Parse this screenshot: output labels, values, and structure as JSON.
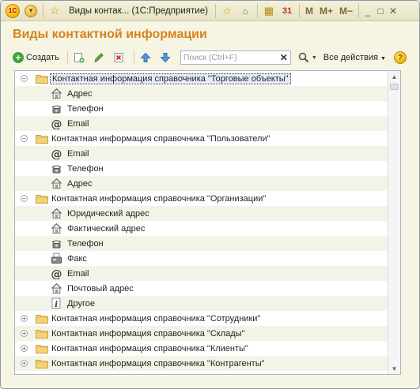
{
  "titlebar": {
    "logo_text": "1С",
    "title": "Виды контак...  (1С:Предприятие)",
    "m": "M",
    "m_plus": "M+",
    "m_minus": "M−"
  },
  "form": {
    "title": "Виды контактной информации"
  },
  "toolbar": {
    "create_label": "Создать",
    "search_placeholder": "Поиск (Ctrl+F)",
    "all_actions_label": "Все действия",
    "help_label": "?"
  },
  "tree": {
    "rows": [
      {
        "type": "group",
        "expanded": true,
        "label": "Контактная информация справочника \"Торговые объекты\"",
        "selected": true
      },
      {
        "type": "item",
        "icon": "house-icon",
        "label": "Адрес"
      },
      {
        "type": "item",
        "icon": "phone-icon",
        "label": "Телефон"
      },
      {
        "type": "item",
        "icon": "email-at-icon",
        "label": "Email"
      },
      {
        "type": "group",
        "expanded": true,
        "label": "Контактная информация справочника \"Пользователи\""
      },
      {
        "type": "item",
        "icon": "email-at-icon",
        "label": "Email"
      },
      {
        "type": "item",
        "icon": "phone-icon",
        "label": "Телефон"
      },
      {
        "type": "item",
        "icon": "house-icon",
        "label": "Адрес"
      },
      {
        "type": "group",
        "expanded": true,
        "label": "Контактная информация справочника \"Организации\""
      },
      {
        "type": "item",
        "icon": "house-icon",
        "label": "Юридический адрес"
      },
      {
        "type": "item",
        "icon": "house-icon",
        "label": "Фактический адрес"
      },
      {
        "type": "item",
        "icon": "phone-icon",
        "label": "Телефон"
      },
      {
        "type": "item",
        "icon": "fax-icon",
        "label": "Факс"
      },
      {
        "type": "item",
        "icon": "email-at-icon",
        "label": "Email"
      },
      {
        "type": "item",
        "icon": "house-icon",
        "label": "Почтовый адрес"
      },
      {
        "type": "item",
        "icon": "info-icon",
        "label": "Другое"
      },
      {
        "type": "group",
        "expanded": false,
        "label": "Контактная информация справочника \"Сотрудники\""
      },
      {
        "type": "group",
        "expanded": false,
        "label": "Контактная информация справочника \"Склады\""
      },
      {
        "type": "group",
        "expanded": false,
        "label": "Контактная информация справочника \"Клиенты\""
      },
      {
        "type": "group",
        "expanded": false,
        "label": "Контактная информация справочника \"Контрагенты\""
      }
    ]
  }
}
